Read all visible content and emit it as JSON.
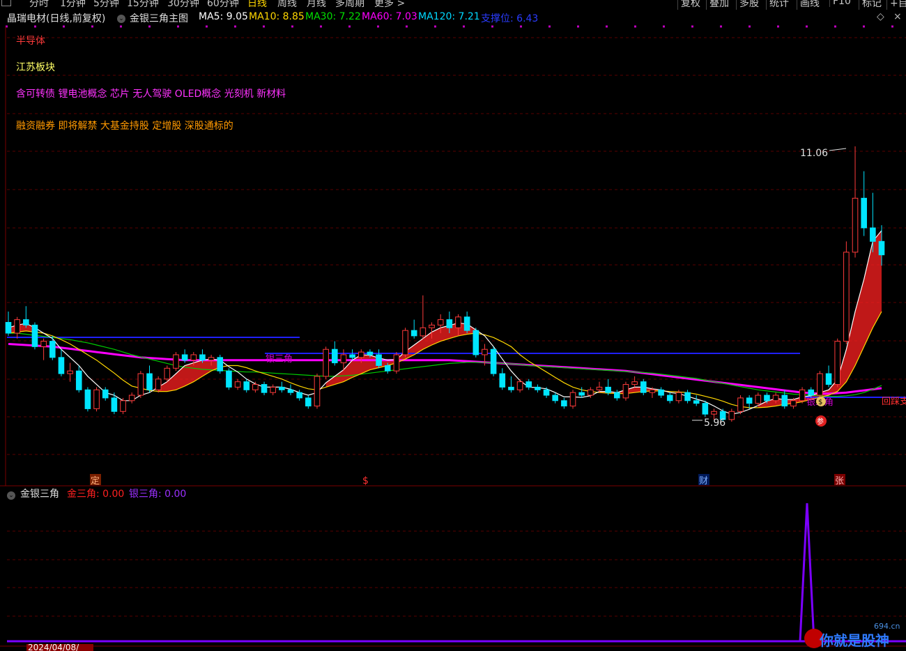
{
  "toolbar": {
    "tabs": [
      "分时",
      "1分钟",
      "5分钟",
      "15分钟",
      "30分钟",
      "60分钟",
      "日线",
      "周线",
      "月线",
      "多周期",
      "更多 >"
    ],
    "active_tab": "日线",
    "right_buttons": [
      "复权",
      "叠加",
      "多股",
      "统计",
      "画线",
      "F10",
      "标记",
      "+自"
    ]
  },
  "legend": {
    "title": "晶瑞电材(日线,前复权)",
    "indicator": "金银三角主图",
    "ma5": "MA5: 9.05",
    "ma10": "MA10: 8.85",
    "ma30": "MA30: 7.22",
    "ma60": "MA60: 7.03",
    "ma120": "MA120: 7.21",
    "support": "支撑位: 6.43"
  },
  "categories": {
    "industry": "半导体",
    "region": "江苏板块",
    "concepts": "含可转债 锂电池概念 芯片 无人驾驶 OLED概念 光刻机 新材料",
    "styles": "融资融券 即将解禁 大基金持股 定增股 深股通标的"
  },
  "chart_labels": {
    "high": "11.06",
    "low": "5.96",
    "silver_triangle_1": "银三角",
    "silver_triangle_2": "银三角",
    "pullback": "回踩支",
    "participate": "参",
    "money_icon": "$"
  },
  "markers": {
    "ding": "定",
    "dollar": "$",
    "cai": "财",
    "zhang": "张"
  },
  "sub_indicator": {
    "name": "金银三角",
    "gold": "金三角: 0.00",
    "silver": "银三角: 0.00"
  },
  "date_label": "2024/04/08/",
  "watermark": {
    "site": "694.cn",
    "text": "你就是股神"
  },
  "colors": {
    "up": "#ff3b3b",
    "down": "#00e5ff",
    "ma5": "#ffffff",
    "ma10": "#ffd700",
    "ma30": "#00cc00",
    "ma60": "#ff00ff",
    "support": "#3333ff",
    "silver_line": "#8a2be2"
  },
  "chart_data": {
    "type": "candlestick",
    "x": "daily bars (approx. 98 sessions, read visually)",
    "price_range": [
      5.5,
      11.5
    ],
    "high": 11.06,
    "low": 5.96,
    "support_level": 6.43,
    "ohlc": [
      [
        7.8,
        8.0,
        7.55,
        7.6
      ],
      [
        7.6,
        7.9,
        7.5,
        7.85
      ],
      [
        7.85,
        8.1,
        7.7,
        7.75
      ],
      [
        7.75,
        7.8,
        7.3,
        7.35
      ],
      [
        7.35,
        7.5,
        7.1,
        7.45
      ],
      [
        7.45,
        7.55,
        7.1,
        7.15
      ],
      [
        7.15,
        7.3,
        6.8,
        6.85
      ],
      [
        6.85,
        7.05,
        6.7,
        6.9
      ],
      [
        6.9,
        7.0,
        6.5,
        6.55
      ],
      [
        6.55,
        6.6,
        6.15,
        6.2
      ],
      [
        6.2,
        6.6,
        6.15,
        6.55
      ],
      [
        6.55,
        6.6,
        6.35,
        6.4
      ],
      [
        6.4,
        6.5,
        6.1,
        6.15
      ],
      [
        6.15,
        6.4,
        6.1,
        6.35
      ],
      [
        6.35,
        6.5,
        6.3,
        6.45
      ],
      [
        6.45,
        6.9,
        6.4,
        6.85
      ],
      [
        6.85,
        7.0,
        6.5,
        6.55
      ],
      [
        6.55,
        6.8,
        6.5,
        6.75
      ],
      [
        6.75,
        7.0,
        6.7,
        6.95
      ],
      [
        6.95,
        7.25,
        6.9,
        7.2
      ],
      [
        7.2,
        7.3,
        7.05,
        7.1
      ],
      [
        7.1,
        7.25,
        7.0,
        7.2
      ],
      [
        7.2,
        7.3,
        7.05,
        7.1
      ],
      [
        7.1,
        7.2,
        7.0,
        7.15
      ],
      [
        7.15,
        7.2,
        6.85,
        6.9
      ],
      [
        6.9,
        6.95,
        6.55,
        6.6
      ],
      [
        6.6,
        6.75,
        6.55,
        6.7
      ],
      [
        6.7,
        6.75,
        6.5,
        6.55
      ],
      [
        6.55,
        6.7,
        6.5,
        6.65
      ],
      [
        6.65,
        6.7,
        6.45,
        6.5
      ],
      [
        6.5,
        6.65,
        6.45,
        6.6
      ],
      [
        6.6,
        6.7,
        6.5,
        6.55
      ],
      [
        6.55,
        6.65,
        6.45,
        6.5
      ],
      [
        6.5,
        6.55,
        6.35,
        6.4
      ],
      [
        6.4,
        6.45,
        6.2,
        6.25
      ],
      [
        6.25,
        6.85,
        6.2,
        6.8
      ],
      [
        6.8,
        7.35,
        6.75,
        7.3
      ],
      [
        7.3,
        7.45,
        7.0,
        7.05
      ],
      [
        7.05,
        7.3,
        6.9,
        7.2
      ],
      [
        7.2,
        7.3,
        7.1,
        7.15
      ],
      [
        7.15,
        7.3,
        7.05,
        7.25
      ],
      [
        7.25,
        7.3,
        7.15,
        7.2
      ],
      [
        7.2,
        7.3,
        6.95,
        7.0
      ],
      [
        7.0,
        7.05,
        6.85,
        6.9
      ],
      [
        6.9,
        7.25,
        6.85,
        7.2
      ],
      [
        7.2,
        7.7,
        7.15,
        7.65
      ],
      [
        7.65,
        7.85,
        7.5,
        7.55
      ],
      [
        7.55,
        8.3,
        7.5,
        7.7
      ],
      [
        7.7,
        7.8,
        7.5,
        7.75
      ],
      [
        7.75,
        7.95,
        7.6,
        7.85
      ],
      [
        7.85,
        8.0,
        7.6,
        7.7
      ],
      [
        7.7,
        7.95,
        7.55,
        7.9
      ],
      [
        7.9,
        8.0,
        7.6,
        7.65
      ],
      [
        7.65,
        7.7,
        7.15,
        7.2
      ],
      [
        7.2,
        7.4,
        7.0,
        7.3
      ],
      [
        7.3,
        7.35,
        6.8,
        6.85
      ],
      [
        6.85,
        6.95,
        6.55,
        6.6
      ],
      [
        6.6,
        6.8,
        6.5,
        6.55
      ],
      [
        6.55,
        6.75,
        6.5,
        6.7
      ],
      [
        6.7,
        6.75,
        6.55,
        6.6
      ],
      [
        6.6,
        6.65,
        6.5,
        6.55
      ],
      [
        6.55,
        6.6,
        6.4,
        6.45
      ],
      [
        6.45,
        6.5,
        6.3,
        6.35
      ],
      [
        6.35,
        6.4,
        6.2,
        6.25
      ],
      [
        6.25,
        6.55,
        6.2,
        6.5
      ],
      [
        6.5,
        6.6,
        6.4,
        6.45
      ],
      [
        6.45,
        6.6,
        6.4,
        6.55
      ],
      [
        6.55,
        6.7,
        6.5,
        6.6
      ],
      [
        6.6,
        6.75,
        6.45,
        6.5
      ],
      [
        6.5,
        6.55,
        6.35,
        6.4
      ],
      [
        6.4,
        6.7,
        6.35,
        6.65
      ],
      [
        6.65,
        6.8,
        6.6,
        6.7
      ],
      [
        6.7,
        6.75,
        6.45,
        6.5
      ],
      [
        6.5,
        6.6,
        6.4,
        6.55
      ],
      [
        6.55,
        6.6,
        6.4,
        6.45
      ],
      [
        6.45,
        6.5,
        6.3,
        6.35
      ],
      [
        6.35,
        6.55,
        6.3,
        6.5
      ],
      [
        6.5,
        6.55,
        6.3,
        6.35
      ],
      [
        6.35,
        6.45,
        6.25,
        6.3
      ],
      [
        6.3,
        6.35,
        6.05,
        6.1
      ],
      [
        6.1,
        6.2,
        6.0,
        6.15
      ],
      [
        6.15,
        6.2,
        5.96,
        6.0
      ],
      [
        6.0,
        6.2,
        5.96,
        6.15
      ],
      [
        6.15,
        6.45,
        6.1,
        6.4
      ],
      [
        6.4,
        6.45,
        6.2,
        6.3
      ],
      [
        6.3,
        6.5,
        6.25,
        6.45
      ],
      [
        6.45,
        6.5,
        6.3,
        6.35
      ],
      [
        6.35,
        6.5,
        6.3,
        6.45
      ],
      [
        6.45,
        6.55,
        6.2,
        6.25
      ],
      [
        6.25,
        6.4,
        6.2,
        6.35
      ],
      [
        6.35,
        6.6,
        6.3,
        6.55
      ],
      [
        6.55,
        6.6,
        6.4,
        6.45
      ],
      [
        6.45,
        6.9,
        6.4,
        6.85
      ],
      [
        6.85,
        7.0,
        6.6,
        6.65
      ],
      [
        6.65,
        7.5,
        6.6,
        7.45
      ],
      [
        7.45,
        9.3,
        7.4,
        9.1
      ],
      [
        9.1,
        11.06,
        9.0,
        10.1
      ],
      [
        10.1,
        10.6,
        9.4,
        9.55
      ],
      [
        9.55,
        10.2,
        9.1,
        9.3
      ],
      [
        9.3,
        9.6,
        8.85,
        9.05
      ]
    ],
    "ma5": [
      7.7,
      7.75,
      7.78,
      7.7,
      7.6,
      7.5,
      7.3,
      7.15,
      7.0,
      6.8,
      6.65,
      6.5,
      6.45,
      6.35,
      6.35,
      6.45,
      6.5,
      6.6,
      6.7,
      6.85,
      7.0,
      7.05,
      7.1,
      7.12,
      7.1,
      6.98,
      6.88,
      6.75,
      6.66,
      6.6,
      6.6,
      6.6,
      6.56,
      6.5,
      6.45,
      6.5,
      6.68,
      6.8,
      6.92,
      7.1,
      7.2,
      7.19,
      7.14,
      7.1,
      7.11,
      7.26,
      7.38,
      7.5,
      7.62,
      7.7,
      7.74,
      7.79,
      7.77,
      7.66,
      7.55,
      7.35,
      7.12,
      6.9,
      6.72,
      6.6,
      6.59,
      6.57,
      6.5,
      6.42,
      6.42,
      6.41,
      6.44,
      6.52,
      6.52,
      6.5,
      6.55,
      6.6,
      6.6,
      6.57,
      6.55,
      6.5,
      6.48,
      6.43,
      6.38,
      6.33,
      6.25,
      6.16,
      6.1,
      6.13,
      6.19,
      6.26,
      6.34,
      6.39,
      6.37,
      6.37,
      6.42,
      6.44,
      6.5,
      6.55,
      6.74,
      7.3,
      8.0,
      8.6,
      9.3,
      9.5
    ],
    "ma10": [
      7.6,
      7.62,
      7.64,
      7.62,
      7.6,
      7.55,
      7.48,
      7.4,
      7.3,
      7.2,
      7.1,
      6.98,
      6.86,
      6.73,
      6.62,
      6.58,
      6.54,
      6.52,
      6.52,
      6.55,
      6.62,
      6.7,
      6.8,
      6.9,
      6.97,
      7.0,
      7.0,
      6.96,
      6.9,
      6.85,
      6.8,
      6.75,
      6.68,
      6.62,
      6.57,
      6.55,
      6.6,
      6.65,
      6.7,
      6.78,
      6.85,
      6.92,
      6.96,
      7.0,
      7.05,
      7.12,
      7.2,
      7.3,
      7.38,
      7.45,
      7.5,
      7.55,
      7.58,
      7.6,
      7.57,
      7.52,
      7.44,
      7.35,
      7.2,
      7.08,
      6.98,
      6.88,
      6.78,
      6.68,
      6.6,
      6.55,
      6.52,
      6.5,
      6.49,
      6.48,
      6.48,
      6.5,
      6.52,
      6.53,
      6.53,
      6.52,
      6.51,
      6.5,
      6.47,
      6.43,
      6.39,
      6.34,
      6.28,
      6.24,
      6.22,
      6.22,
      6.23,
      6.25,
      6.28,
      6.3,
      6.33,
      6.37,
      6.41,
      6.45,
      6.52,
      6.7,
      7.0,
      7.35,
      7.7,
      8.0
    ],
    "ma30": [
      7.6,
      7.6,
      7.58,
      7.56,
      7.54,
      7.52,
      7.5,
      7.48,
      7.45,
      7.42,
      7.38,
      7.34,
      7.3,
      7.25,
      7.2,
      7.16,
      7.12,
      7.08,
      7.04,
      7.0,
      6.97,
      6.95,
      6.93,
      6.92,
      6.91,
      6.9,
      6.89,
      6.88,
      6.88,
      6.87,
      6.86,
      6.85,
      6.84,
      6.83,
      6.82,
      6.81,
      6.8,
      6.8,
      6.81,
      6.82,
      6.84,
      6.86,
      6.88,
      6.9,
      6.92,
      6.94,
      6.96,
      6.98,
      7.0,
      7.02,
      7.04,
      7.05,
      7.06,
      7.06,
      7.06,
      7.05,
      7.04,
      7.03,
      7.02,
      7.0,
      6.99,
      6.98,
      6.97,
      6.96,
      6.95,
      6.94,
      6.93,
      6.92,
      6.91,
      6.9,
      6.89,
      6.88,
      6.87,
      6.86,
      6.84,
      6.82,
      6.8,
      6.78,
      6.76,
      6.73,
      6.7,
      6.67,
      6.64,
      6.61,
      6.58,
      6.55,
      6.53,
      6.51,
      6.49,
      6.47,
      6.46,
      6.45,
      6.44,
      6.43,
      6.43,
      6.44,
      6.46,
      6.5,
      6.56,
      6.63
    ],
    "ma60": [
      7.4,
      7.39,
      7.38,
      7.37,
      7.36,
      7.35,
      7.33,
      7.31,
      7.29,
      7.27,
      7.25,
      7.23,
      7.21,
      7.19,
      7.17,
      7.15,
      7.14,
      7.13,
      7.12,
      7.11,
      7.1,
      7.1,
      7.1,
      7.1,
      7.1,
      7.1,
      7.1,
      7.1,
      7.1,
      7.1,
      7.1,
      7.1,
      7.1,
      7.1,
      7.1,
      7.1,
      7.1,
      7.1,
      7.1,
      7.1,
      7.1,
      7.1,
      7.1,
      7.1,
      7.1,
      7.1,
      7.1,
      7.1,
      7.1,
      7.1,
      7.1,
      7.09,
      7.08,
      7.07,
      7.06,
      7.05,
      7.04,
      7.03,
      7.02,
      7.01,
      7.0,
      6.99,
      6.98,
      6.97,
      6.96,
      6.95,
      6.94,
      6.93,
      6.92,
      6.91,
      6.9,
      6.88,
      6.86,
      6.84,
      6.82,
      6.8,
      6.78,
      6.76,
      6.74,
      6.72,
      6.7,
      6.68,
      6.66,
      6.64,
      6.62,
      6.6,
      6.58,
      6.56,
      6.54,
      6.52,
      6.5,
      6.49,
      6.48,
      6.48,
      6.49,
      6.5,
      6.52,
      6.54,
      6.56,
      6.58
    ],
    "subchart": {
      "gold_triangle": 0.0,
      "silver_triangle": 0.0,
      "spike_at_bar": 94
    }
  }
}
